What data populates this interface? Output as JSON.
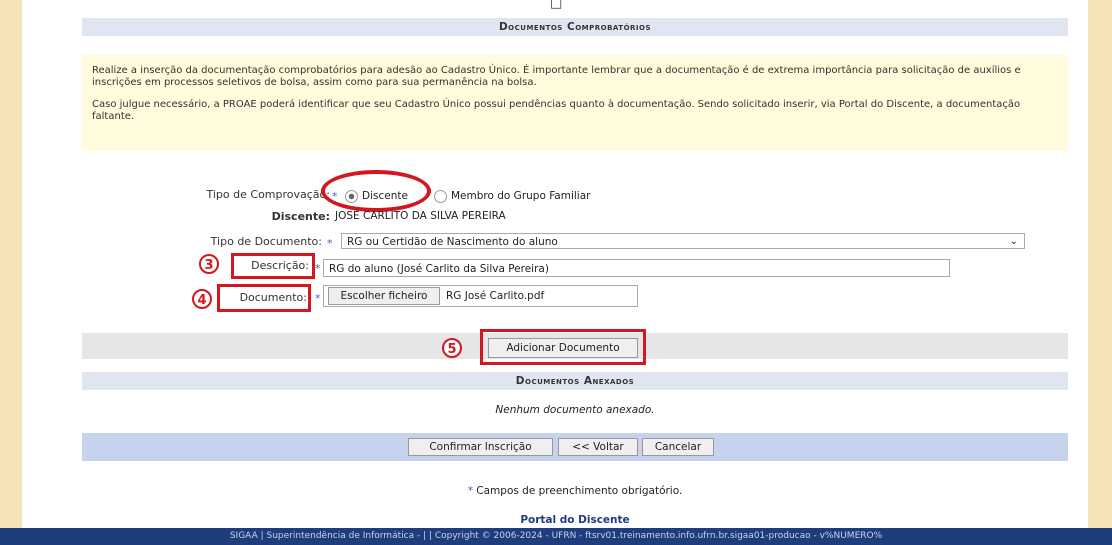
{
  "window_glyph": "□",
  "section_documentos_comprobatorios": "Documentos Comprobatórios",
  "notice": {
    "paragraph1": "Realize a inserção da documentação comprobatórios para adesão ao Cadastro Único. É importante lembrar que a documentação é de extrema importância para solicitação de auxílios e inscrições em processos seletivos de bolsa, assim como para sua permanência na bolsa.",
    "paragraph2": "Caso julgue necessário, a PROAE poderá identificar que seu Cadastro Único possui pendências quanto à documentação. Sendo solicitado inserir, via Portal do Discente, a documentação faltante."
  },
  "form": {
    "tipo_comprovacao_label": "Tipo de Comprovação:",
    "option_discente": "Discente",
    "option_membro": "Membro do Grupo Familiar",
    "discente_label": "Discente:",
    "discente_value": "JOSÉ CARLITO DA SILVA PEREIRA",
    "tipo_documento_label": "Tipo de Documento:",
    "tipo_documento_value": "RG ou Certidão de Nascimento do aluno",
    "descricao_label": "Descrição:",
    "descricao_value": "RG do aluno (José Carlito da Silva Pereira)",
    "documento_label": "Documento:",
    "choose_file_label": "Escolher ficheiro",
    "file_name": "RG José Carlito.pdf",
    "required_mark": "*"
  },
  "annotations": {
    "step3": "3",
    "step4": "4",
    "step5": "5"
  },
  "add_document_button": "Adicionar Documento",
  "section_documentos_anexados": "Documentos Anexados",
  "no_documents_text": "Nenhum documento anexado.",
  "actions": {
    "confirm": "Confirmar Inscrição",
    "back": "<< Voltar",
    "cancel": "Cancelar"
  },
  "required_note": "Campos de preenchimento obrigatório.",
  "portal_link": "Portal do Discente",
  "footer_text": "SIGAA | Superintendência de Informática - | | Copyright © 2006-2024 - UFRN - ftsrv01.treinamento.info.ufrn.br.sigaa01-producao - v%NUMERO%",
  "colors": {
    "annotation_red": "#d4171e",
    "section_header_bg": "#dfe6f2",
    "notice_bg": "#fffbdc",
    "footer_bg": "#1d3d7d",
    "outer_bg": "#f4e4b8"
  }
}
